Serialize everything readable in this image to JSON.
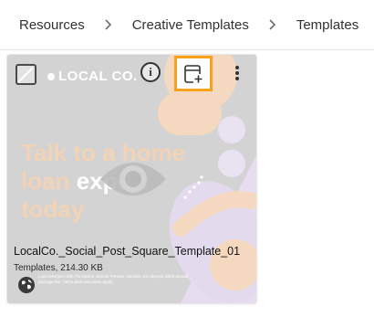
{
  "breadcrumb": {
    "items": [
      "Resources",
      "Creative Templates",
      "Templates"
    ]
  },
  "card": {
    "brand": "LOCAL CO.",
    "headline": {
      "line1": "Talk to a home",
      "line2_a": "loan",
      "line2_b": "expert",
      "line3": "today"
    },
    "title": "LocalCo._Social_Post_Square_Template_01",
    "meta": "Templates, 214.30 KB",
    "fine_print": "Loan Designer with Principal & Interest Premier Variable. 5% deposit, $995 annual package fee. T&Cs and exclusions apply.",
    "icons": {
      "select": "checkbox-icon",
      "info": "info-icon",
      "add": "add-to-collection-icon",
      "more": "more-vertical-icon",
      "preview": "eye-icon",
      "visibility": "globe-icon"
    },
    "colors": {
      "highlight_border": "#f7a21b",
      "accent_peach": "#f2d3b6",
      "accent_lilac": "#e6def0"
    }
  }
}
